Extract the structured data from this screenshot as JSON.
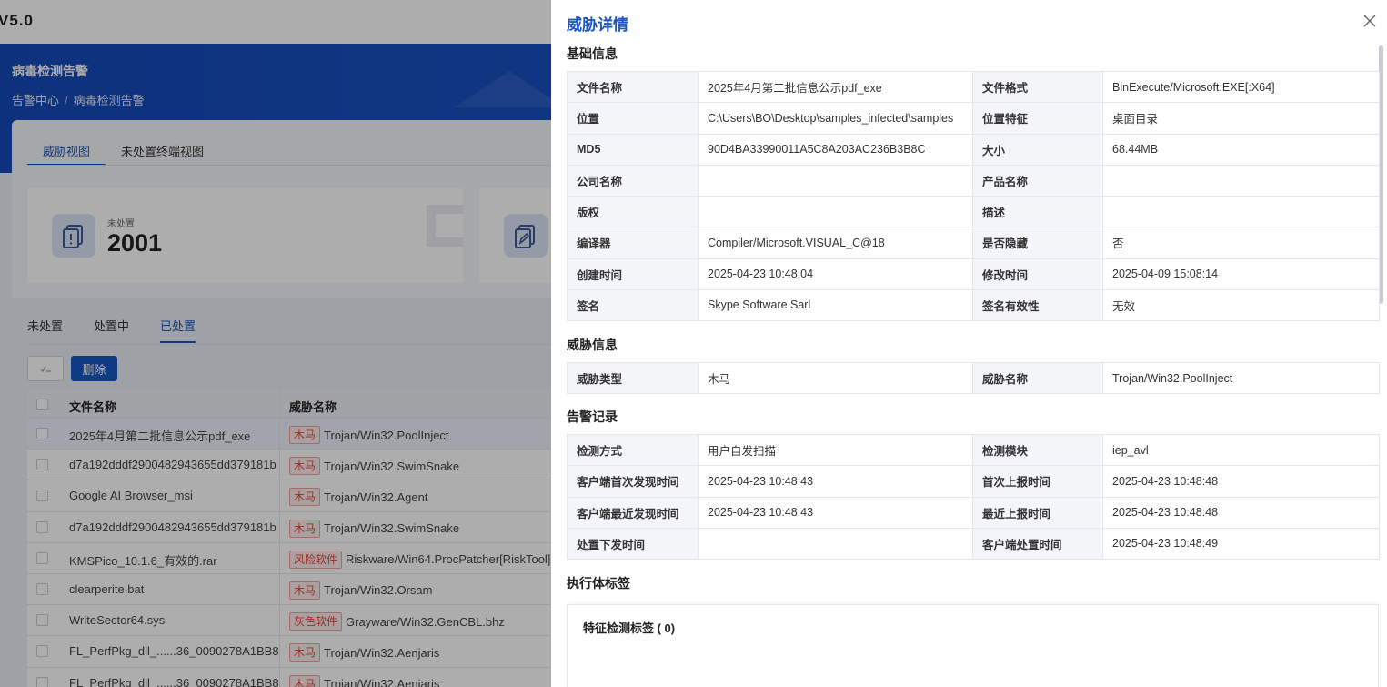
{
  "app": {
    "version_text": "V5.0"
  },
  "hero": {
    "title": "病毒检测告警",
    "breadcrumb": [
      "告警中心",
      "病毒检测告警"
    ]
  },
  "views": [
    "威胁视图",
    "未处置终端视图"
  ],
  "cards": [
    {
      "label": "未处置",
      "value": "2001"
    }
  ],
  "status_tabs": [
    "未处置",
    "处置中",
    "已处置"
  ],
  "toolbar": {
    "delete_label": "删除"
  },
  "table": {
    "headers": [
      "文件名称",
      "威胁名称"
    ],
    "rows": [
      {
        "file": "2025年4月第二批信息公示pdf_exe",
        "tag": "木马",
        "threat": "Trojan/Win32.PoolInject"
      },
      {
        "file": "d7a192dddf2900482943655dd379181b",
        "tag": "木马",
        "threat": "Trojan/Win32.SwimSnake"
      },
      {
        "file": "Google AI Browser_msi",
        "tag": "木马",
        "threat": "Trojan/Win32.Agent"
      },
      {
        "file": "d7a192dddf2900482943655dd379181b",
        "tag": "木马",
        "threat": "Trojan/Win32.SwimSnake"
      },
      {
        "file": "KMSPico_10.1.6_有效的.rar",
        "tag": "风险软件",
        "threat": "Riskware/Win64.ProcPatcher[RiskTool]"
      },
      {
        "file": "clearperite.bat",
        "tag": "木马",
        "threat": "Trojan/Win32.Orsam"
      },
      {
        "file": "WriteSector64.sys",
        "tag": "灰色软件",
        "threat": "Grayware/Win32.GenCBL.bhz"
      },
      {
        "file": "FL_PerfPkg_dll_......36_0090278A1BB8",
        "tag": "木马",
        "threat": "Trojan/Win32.Aenjaris"
      },
      {
        "file": "FL_PerfPkg_dll_......36_0090278A1BB8",
        "tag": "木马",
        "threat": "Trojan/Win32.Aenjaris"
      }
    ]
  },
  "drawer": {
    "title": "威胁详情",
    "sections": {
      "basic": {
        "title": "基础信息",
        "rows": [
          [
            {
              "k": "文件名称",
              "v": "2025年4月第二批信息公示pdf_exe"
            },
            {
              "k": "文件格式",
              "v": "BinExecute/Microsoft.EXE[:X64]"
            }
          ],
          [
            {
              "k": "位置",
              "v": "C:\\Users\\BO\\Desktop\\samples_infected\\samples"
            },
            {
              "k": "位置特征",
              "v": "桌面目录"
            }
          ],
          [
            {
              "k": "MD5",
              "v": "90D4BA33990011A5C8A203AC236B3B8C"
            },
            {
              "k": "大小",
              "v": "68.44MB"
            }
          ],
          [
            {
              "k": "公司名称",
              "v": ""
            },
            {
              "k": "产品名称",
              "v": ""
            }
          ],
          [
            {
              "k": "版权",
              "v": ""
            },
            {
              "k": "描述",
              "v": ""
            }
          ],
          [
            {
              "k": "编译器",
              "v": "Compiler/Microsoft.VISUAL_C@18"
            },
            {
              "k": "是否隐藏",
              "v": "否"
            }
          ],
          [
            {
              "k": "创建时间",
              "v": "2025-04-23 10:48:04"
            },
            {
              "k": "修改时间",
              "v": "2025-04-09 15:08:14"
            }
          ],
          [
            {
              "k": "签名",
              "v": "Skype Software Sarl"
            },
            {
              "k": "签名有效性",
              "v": "无效"
            }
          ]
        ]
      },
      "threat": {
        "title": "威胁信息",
        "rows": [
          [
            {
              "k": "威胁类型",
              "v": "木马"
            },
            {
              "k": "威胁名称",
              "v": "Trojan/Win32.PoolInject"
            }
          ]
        ]
      },
      "alert": {
        "title": "告警记录",
        "rows": [
          [
            {
              "k": "检测方式",
              "v": "用户自发扫描"
            },
            {
              "k": "检测模块",
              "v": "iep_avl"
            }
          ],
          [
            {
              "k": "客户端首次发现时间",
              "v": "2025-04-23 10:48:43"
            },
            {
              "k": "首次上报时间",
              "v": "2025-04-23 10:48:48"
            }
          ],
          [
            {
              "k": "客户端最近发现时间",
              "v": "2025-04-23 10:48:43"
            },
            {
              "k": "最近上报时间",
              "v": "2025-04-23 10:48:48"
            }
          ],
          [
            {
              "k": "处置下发时间",
              "v": ""
            },
            {
              "k": "客户端处置时间",
              "v": "2025-04-23 10:48:49"
            }
          ]
        ]
      },
      "exec_tags": {
        "title": "执行体标签",
        "feature_label": "特征检测标签 ( 0)"
      }
    }
  }
}
